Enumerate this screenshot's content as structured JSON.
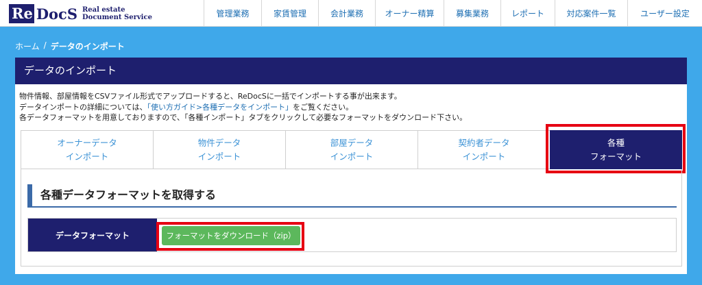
{
  "header": {
    "logo": {
      "re": "Re",
      "docs": "DocS",
      "sub_line1": "Real estate",
      "sub_line2": "Document Service"
    },
    "nav": [
      {
        "label": "管理業務"
      },
      {
        "label": "家賃管理"
      },
      {
        "label": "会計業務"
      },
      {
        "label": "オーナー精算"
      },
      {
        "label": "募集業務"
      },
      {
        "label": "レポート"
      },
      {
        "label": "対応案件一覧"
      },
      {
        "label": "ユーザー設定"
      }
    ]
  },
  "breadcrumb": {
    "home": "ホーム",
    "separator": "/",
    "current": "データのインポート"
  },
  "panel": {
    "title": "データのインポート",
    "desc_line1": "物件情報、部屋情報をCSVファイル形式でアップロードすると、ReDocSに一括でインポートする事が出来ます。",
    "desc_line2_pre": "データインポートの詳細については、",
    "desc_line2_link": "「使い方ガイド>各種データをインポート」",
    "desc_line2_post": "をご覧ください。",
    "desc_line3": "各データフォーマットを用意しておりますので、「各種インポート」タブをクリックして必要なフォーマットをダウンロード下さい。"
  },
  "tabs": [
    {
      "line1": "オーナーデータ",
      "line2": "インポート",
      "active": false
    },
    {
      "line1": "物件データ",
      "line2": "インポート",
      "active": false
    },
    {
      "line1": "部屋データ",
      "line2": "インポート",
      "active": false
    },
    {
      "line1": "契約者データ",
      "line2": "インポート",
      "active": false
    },
    {
      "line1": "各種",
      "line2": "フォーマット",
      "active": true
    }
  ],
  "content": {
    "section_title": "各種データフォーマットを取得する",
    "format_label": "データフォーマット",
    "download_button": "フォーマットをダウンロード（zip）"
  },
  "colors": {
    "navy": "#1e1f6e",
    "background": "#3fa8ea",
    "highlight": "#e60012",
    "button_green": "#5cb85c",
    "link": "#1e6fb3"
  }
}
